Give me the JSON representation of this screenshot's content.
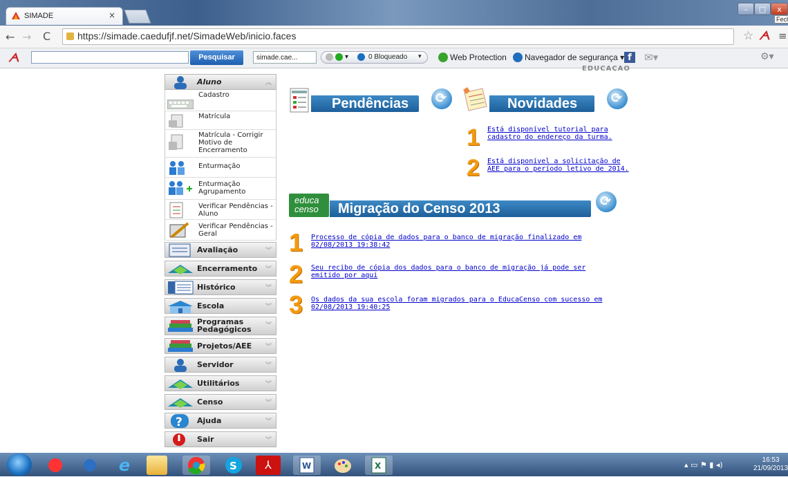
{
  "browser": {
    "tab_title": "SIMADE",
    "tab_close": "×",
    "url": "https://simade.caedufjf.net/SimadeWeb/inicio.faces",
    "tooltip_close": "Fech"
  },
  "toolbar": {
    "search_value": "",
    "search_button": "Pesquisar",
    "site_box": "simade.cae...",
    "blocked": "0 Bloqueado",
    "web_protection": "Web Protection",
    "nav_security": "Navegador de segurança"
  },
  "page": {
    "header_partial": "EDUCAÇÃO"
  },
  "sidebar": {
    "aluno": {
      "label": "Aluno",
      "items": [
        {
          "label": "Cadastro"
        },
        {
          "label": "Matrícula"
        },
        {
          "label": "Matrícula - Corrigir Motivo de Encerramento"
        },
        {
          "label": "Enturmação"
        },
        {
          "label": "Enturmação Agrupamento"
        },
        {
          "label": "Verificar Pendências - Aluno"
        },
        {
          "label": "Verificar Pendências - Geral"
        }
      ]
    },
    "sections": [
      {
        "label": "Avaliação"
      },
      {
        "label": "Encerramento"
      },
      {
        "label": "Histórico"
      },
      {
        "label": "Escola"
      },
      {
        "label": "Programas Pedagógicos"
      },
      {
        "label": "Projetos/AEE"
      },
      {
        "label": "Servidor"
      },
      {
        "label": "Utilitários"
      },
      {
        "label": "Censo"
      },
      {
        "label": "Ajuda"
      },
      {
        "label": "Sair"
      }
    ]
  },
  "pendencias": {
    "title": "Pendências"
  },
  "novidades": {
    "title": "Novidades",
    "items": [
      {
        "num": "1",
        "text": "Está disponível tutorial para cadastro do endereço da turma."
      },
      {
        "num": "2",
        "text": "Está disponível a solicitação de AEE para o período letivo de 2014."
      }
    ]
  },
  "censo": {
    "logo_line1": "educa",
    "logo_line2": "censo",
    "title": "Migração do Censo 2013",
    "items": [
      {
        "num": "1",
        "text": "Processo de cópia de dados para o banco de migração finalizado em 02/08/2013 19:38:42"
      },
      {
        "num": "2",
        "text": "Seu recibo de cópia dos dados para o banco de migração já pode ser emitido por aqui"
      },
      {
        "num": "3",
        "text": "Os dados da sua escola foram migrados para o EducaCenso com sucesso em 02/08/2013 19:40:25"
      }
    ]
  },
  "taskbar": {
    "time": "16:53",
    "date": "21/09/2013"
  }
}
